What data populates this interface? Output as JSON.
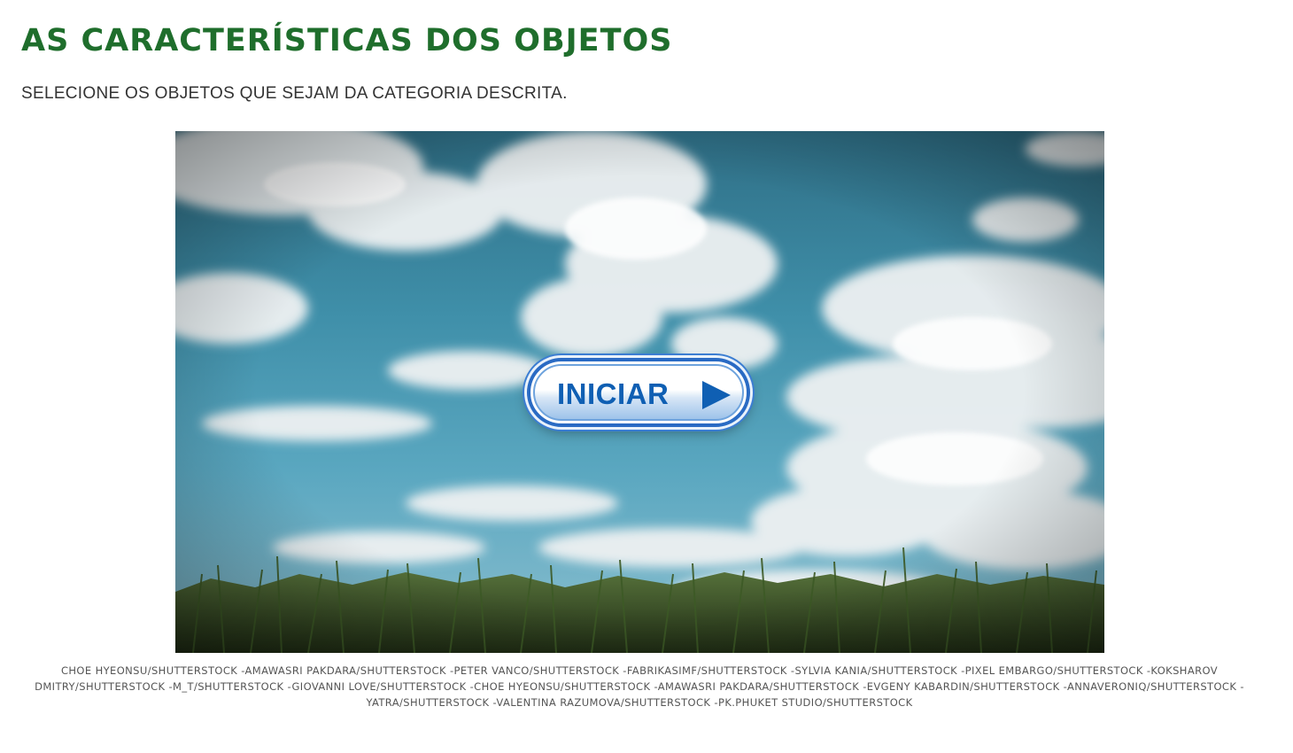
{
  "page": {
    "title": "AS CARACTERÍSTICAS DOS OBJETOS",
    "instructions": "SELECIONE OS OBJETOS QUE SEJAM DA CATEGORIA DESCRITA."
  },
  "activity": {
    "start_label": "INICIAR",
    "start_icon": "play-arrow-icon",
    "scene": "sky-with-clouds-over-cornfield"
  },
  "credits": "CHOE HYEONSU/SHUTTERSTOCK -AMAWASRI PAKDARA/SHUTTERSTOCK -PETER VANCO/SHUTTERSTOCK -FABRIKASIMF/SHUTTERSTOCK -SYLVIA KANIA/SHUTTERSTOCK -PIXEL EMBARGO/SHUTTERSTOCK -KOKSHAROV DMITRY/SHUTTERSTOCK -M_T/SHUTTERSTOCK -GIOVANNI LOVE/SHUTTERSTOCK -CHOE HYEONSU/SHUTTERSTOCK -AMAWASRI PAKDARA/SHUTTERSTOCK -EVGENY KABARDIN/SHUTTERSTOCK -ANNAVERONIQ/SHUTTERSTOCK -YATRA/SHUTTERSTOCK -VALENTINA RAZUMOVA/SHUTTERSTOCK -PK.PHUKET STUDIO/SHUTTERSTOCK",
  "colors": {
    "title": "#1f6e2c",
    "button_text": "#0f5fb3",
    "button_border": "#2a6bc4"
  }
}
